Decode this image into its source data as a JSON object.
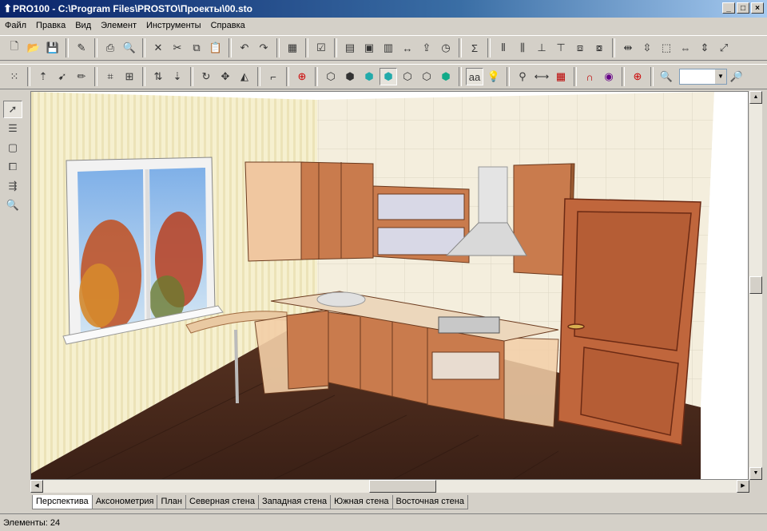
{
  "window": {
    "title": "PRO100 - C:\\Program Files\\PROSTO\\Проекты\\00.sto",
    "minimize": "_",
    "maximize": "□",
    "close": "×"
  },
  "menu": [
    "Файл",
    "Правка",
    "Вид",
    "Элемент",
    "Инструменты",
    "Справка"
  ],
  "toolbar": {
    "sum_symbol": "Σ",
    "text_tool": "aa"
  },
  "tabs": [
    "Перспектива",
    "Аксонометрия",
    "План",
    "Северная стена",
    "Западная стена",
    "Южная стена",
    "Восточная стена"
  ],
  "active_tab": "Перспектива",
  "status": {
    "elements_text": "Элементы: 24"
  },
  "colors": {
    "wood": "#c97b4d",
    "wood_dark": "#7a3f22",
    "floor": "#4a2a1c",
    "wall_tile": "#f4eedd",
    "wall_stripe": "#f6f0cf"
  }
}
